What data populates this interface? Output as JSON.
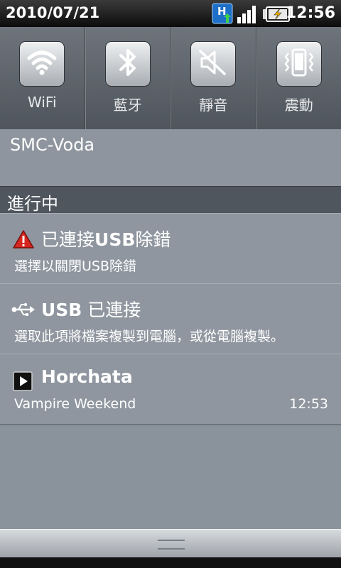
{
  "status_bar": {
    "date": "2010/07/21",
    "time": "12:56",
    "network_badge": "H",
    "icons": [
      "hspa-data-icon",
      "signal-icon",
      "battery-charging-icon"
    ]
  },
  "toggles": [
    {
      "label": "WiFi",
      "icon": "wifi-icon"
    },
    {
      "label": "藍牙",
      "icon": "bluetooth-icon"
    },
    {
      "label": "靜音",
      "icon": "mute-icon"
    },
    {
      "label": "震動",
      "icon": "vibrate-icon"
    }
  ],
  "carrier": "SMC-Voda",
  "ongoing_header": "進行中",
  "notifications": [
    {
      "icon": "warning-icon",
      "title_prefix": "已連接",
      "title_bold": "USB",
      "title_suffix": "除錯",
      "text": "選擇以關閉USB除錯",
      "time": ""
    },
    {
      "icon": "usb-icon",
      "title_prefix": "",
      "title_bold": "USB",
      "title_suffix": " 已連接",
      "text": "選取此項將檔案複製到電腦，或從電腦複製。",
      "time": ""
    },
    {
      "icon": "play-icon",
      "title_prefix": "",
      "title_bold": "Horchata",
      "title_suffix": "",
      "text": "Vampire Weekend",
      "time": "12:53"
    }
  ],
  "colors": {
    "panel_bg": "#8a929c",
    "header_bg": "#4f565e",
    "status_bar_bg": "#0c0c0c"
  }
}
